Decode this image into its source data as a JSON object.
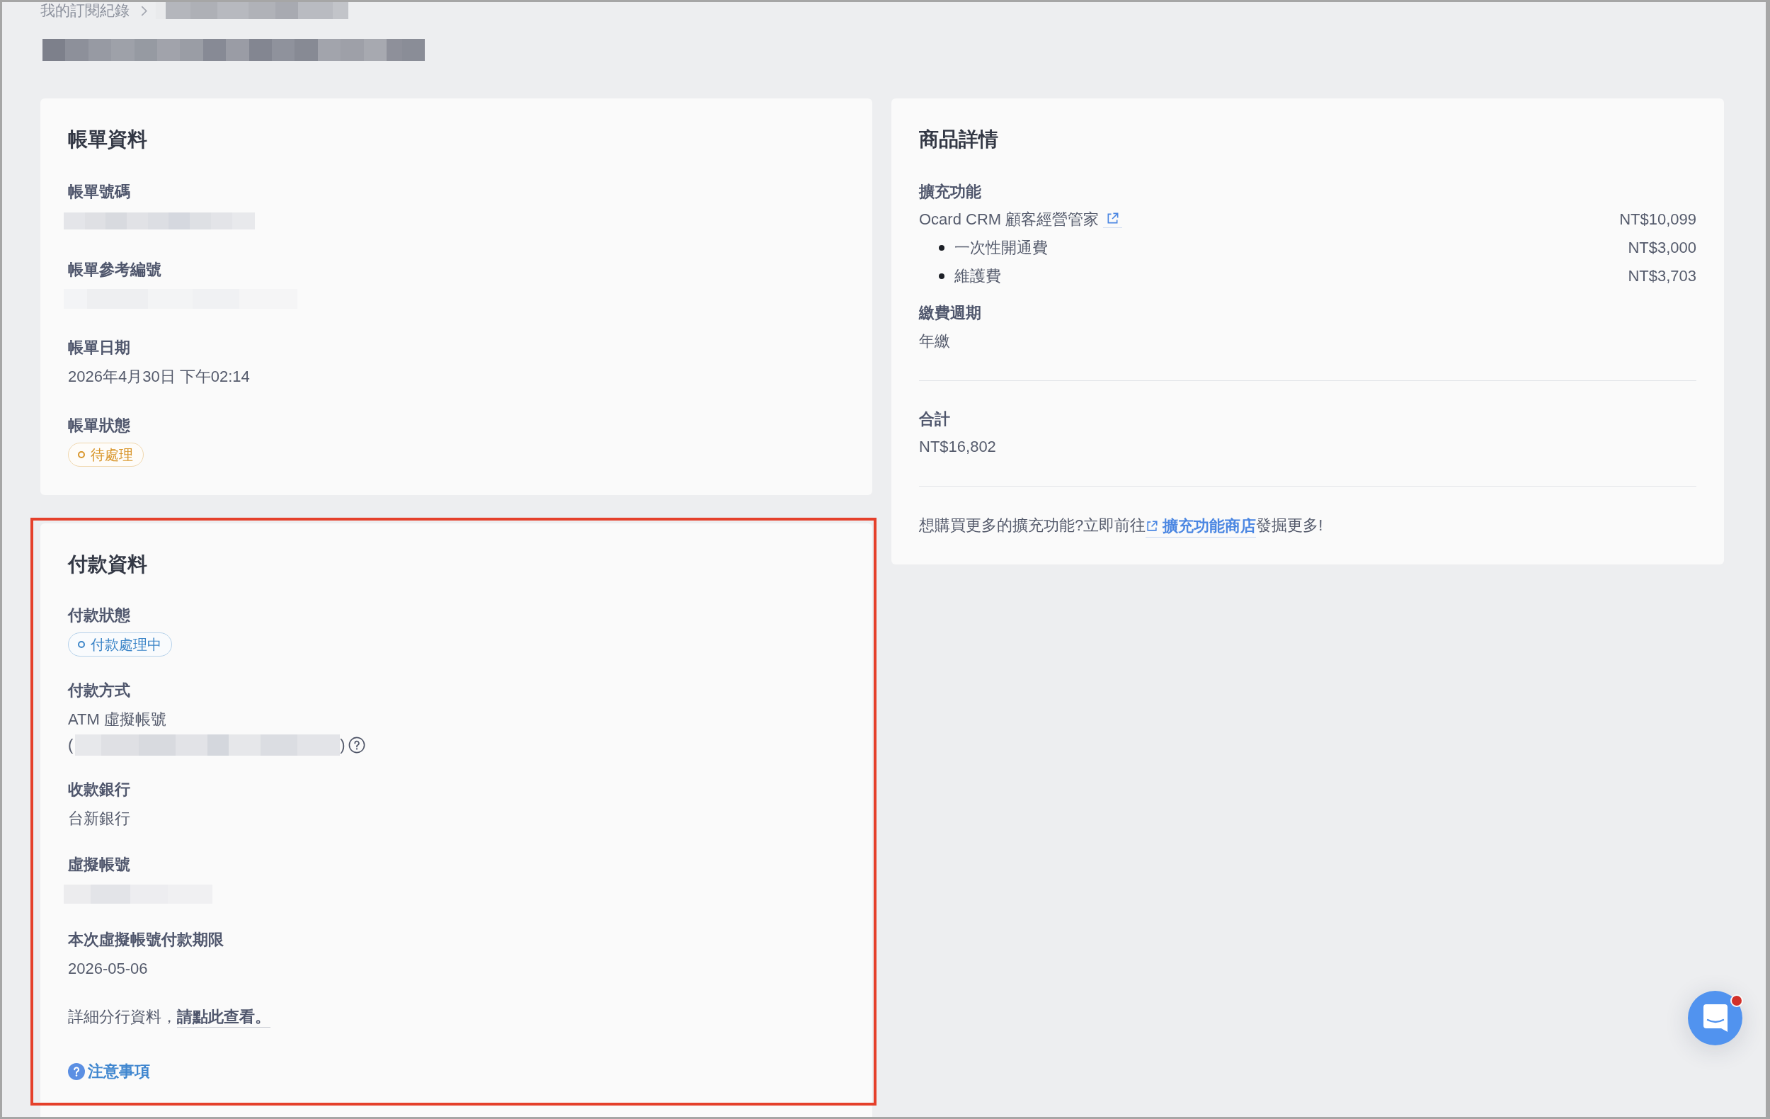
{
  "breadcrumb": {
    "link": "我的訂閱紀錄",
    "current_hidden": true
  },
  "page_title_hidden": true,
  "billing": {
    "title": "帳單資料",
    "fields": [
      {
        "label": "帳單號碼",
        "kind": "hidden"
      },
      {
        "label": "帳單參考編號",
        "kind": "hidden"
      },
      {
        "label": "帳單日期",
        "kind": "text",
        "value": "2026年4月30日 下午02:14"
      },
      {
        "label": "帳單狀態",
        "kind": "badge",
        "value": "待處理",
        "color": "#d8952a"
      }
    ]
  },
  "payment": {
    "title": "付款資料",
    "highlighted": true,
    "fields": [
      {
        "label": "付款狀態",
        "kind": "badge",
        "value": "付款處理中",
        "color": "#3d86c8"
      },
      {
        "label": "付款方式",
        "kind": "method",
        "value": "ATM 虛擬帳號",
        "open": "(",
        "close": ")"
      },
      {
        "label": "收款銀行",
        "kind": "text",
        "value": "台新銀行"
      },
      {
        "label": "虛擬帳號",
        "kind": "hidden"
      },
      {
        "label": "本次虛擬帳號付款期限",
        "kind": "text",
        "value": "2026-05-06"
      }
    ],
    "note": {
      "text": "詳細分行資料，",
      "link": "請點此查看。"
    },
    "notice_link": "注意事項"
  },
  "product": {
    "title": "商品詳情",
    "label": "擴充功能",
    "name": "Ocard CRM 顧客經營管家",
    "price": "NT$10,099",
    "items": [
      {
        "name": "一次性開通費",
        "price": "NT$3,000"
      },
      {
        "name": "維護費",
        "price": "NT$3,703"
      }
    ],
    "cycle_label": "繳費週期",
    "cycle": "年繳",
    "total_label": "合計",
    "total": "NT$16,802",
    "footer": {
      "before": "想購買更多的擴充功能?立即前往",
      "link": "擴充功能商店",
      "after": "發掘更多!"
    }
  },
  "chat": {
    "unread": true
  }
}
